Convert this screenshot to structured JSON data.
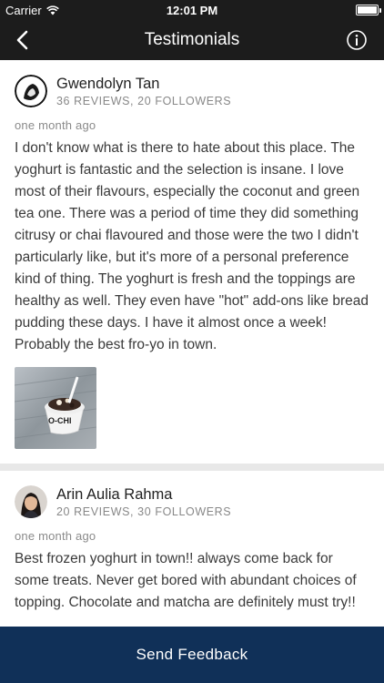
{
  "status_bar": {
    "carrier": "Carrier",
    "time": "12:01 PM",
    "wifi_icon": "wifi-icon",
    "battery_icon": "battery-icon",
    "battery_level": 1.0
  },
  "nav": {
    "title": "Testimonials",
    "back_icon": "chevron-left-icon",
    "info_icon": "info-circle-icon"
  },
  "reviews": [
    {
      "name": "Gwendolyn Tan",
      "stats": "36 REVIEWS, 20 FOLLOWERS",
      "date": "one month ago",
      "text": "I don't know what is there to hate about this place. The yoghurt is fantastic and the selection is insane. I love most of their flavours, especially the coconut and green tea one. There was a period of time they did something citrusy or chai flavoured and those were the two I didn't particularly like, but it's more of a personal preference kind of thing. The yoghurt is fresh and the toppings are healthy as well. They even have \"hot\" add-ons like bread pudding these days. I have it almost once a week! Probably the best fro-yo in town.",
      "photo_caption": "O-CHI"
    },
    {
      "name": "Arin Aulia Rahma",
      "stats": "20 REVIEWS, 30 FOLLOWERS",
      "date": "one month ago",
      "text": "Best frozen yoghurt in town!! always come back for some treats. Never get bored with abundant choices of topping. Chocolate and matcha are definitely must try!!"
    }
  ],
  "footer": {
    "send_feedback": "Send Feedback"
  },
  "colors": {
    "nav_background": "#1c1c1c",
    "footer_background": "#103058",
    "separator": "#e8e8e8"
  }
}
